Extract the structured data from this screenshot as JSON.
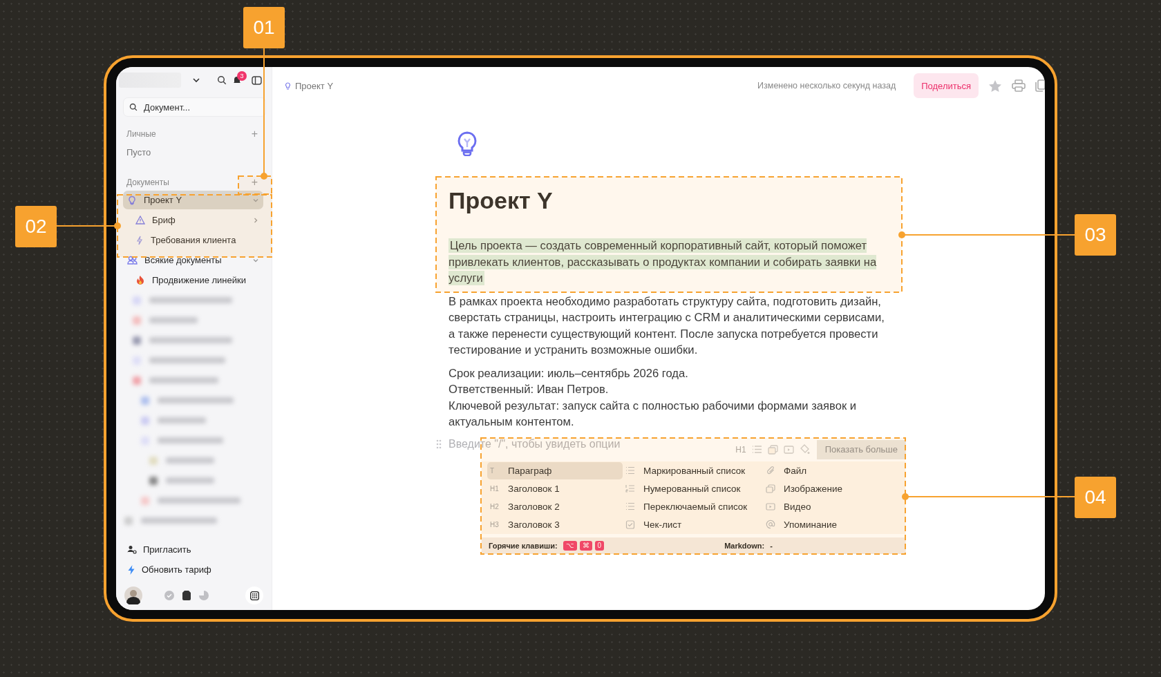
{
  "sidebar": {
    "notification_count": "3",
    "search": {
      "placeholder": "Документ..."
    },
    "personal": {
      "title": "Личные",
      "add_button": "+",
      "empty_text": "Пусто"
    },
    "documents": {
      "title": "Документы",
      "add_button": "+",
      "items": [
        {
          "label": "Проект Y",
          "kind": "bulb",
          "selected": true,
          "expanded": true,
          "children": [
            {
              "label": "Бриф",
              "kind": "warning",
              "selected": false,
              "expanded": false
            },
            {
              "label": "Требования клиента",
              "kind": "bolt",
              "selected": false
            }
          ]
        },
        {
          "label": "Всякие документы",
          "kind": "people",
          "selected": false,
          "expanded": true,
          "children": [
            {
              "label": "Продвижение линейки",
              "kind": "fire",
              "selected": false
            }
          ]
        }
      ]
    },
    "footer_links": [
      {
        "label": "Пригласить",
        "kind": "invite"
      },
      {
        "label": "Обновить тариф",
        "kind": "upgrade"
      }
    ]
  },
  "header": {
    "breadcrumb": "Проект Y",
    "status": "Изменено несколько секунд назад",
    "share_button": "Поделиться"
  },
  "document": {
    "title": "Проект Y",
    "highlighted_paragraph": "Цель проекта — создать современный корпоративный сайт, который поможет привлекать клиентов, рассказывать о продуктах компании и собирать заявки на услуги",
    "paragraph": "В рамках проекта необходимо разработать структуру сайта, подготовить дизайн, сверстать страницы, настроить интеграцию с CRM и аналитическими сервисами, а также перенести существующий контент. После запуска потребуется провести тестирование и устранить возможные ошибки.",
    "lines": [
      "Срок реализации: июль–сентябрь 2026 года.",
      "Ответственный: Иван Петров.",
      "Ключевой результат: запуск сайта с полностью рабочими формами заявок и актуальным контентом."
    ],
    "block_placeholder": "Введите \"/\", чтобы увидеть опции"
  },
  "block_menu": {
    "toolbar_glyph": "H1",
    "show_more_button": "Показать больше",
    "columns": [
      [
        {
          "label": "Параграф",
          "glyph": "T",
          "selected": true
        },
        {
          "label": "Заголовок 1",
          "glyph": "H1",
          "selected": false
        },
        {
          "label": "Заголовок 2",
          "glyph": "H2",
          "selected": false
        },
        {
          "label": "Заголовок 3",
          "glyph": "H3",
          "selected": false
        }
      ],
      [
        {
          "label": "Маркированный список",
          "kind": "bullets",
          "selected": false
        },
        {
          "label": "Нумерованный список",
          "kind": "numbered",
          "selected": false
        },
        {
          "label": "Переключаемый список",
          "kind": "toggle",
          "selected": false
        },
        {
          "label": "Чек-лист",
          "kind": "checklist",
          "selected": false
        }
      ],
      [
        {
          "label": "Файл",
          "kind": "file",
          "selected": false
        },
        {
          "label": "Изображение",
          "kind": "image",
          "selected": false
        },
        {
          "label": "Видео",
          "kind": "video",
          "selected": false
        },
        {
          "label": "Упоминание",
          "kind": "mention",
          "selected": false
        }
      ]
    ],
    "hotkeys_label": "Горячие клавиши:",
    "hotkeys": [
      "⌥",
      "⌘",
      "0"
    ],
    "markdown_label": "Markdown:",
    "markdown_value": "-"
  },
  "callouts": [
    "01",
    "02",
    "03",
    "04"
  ]
}
